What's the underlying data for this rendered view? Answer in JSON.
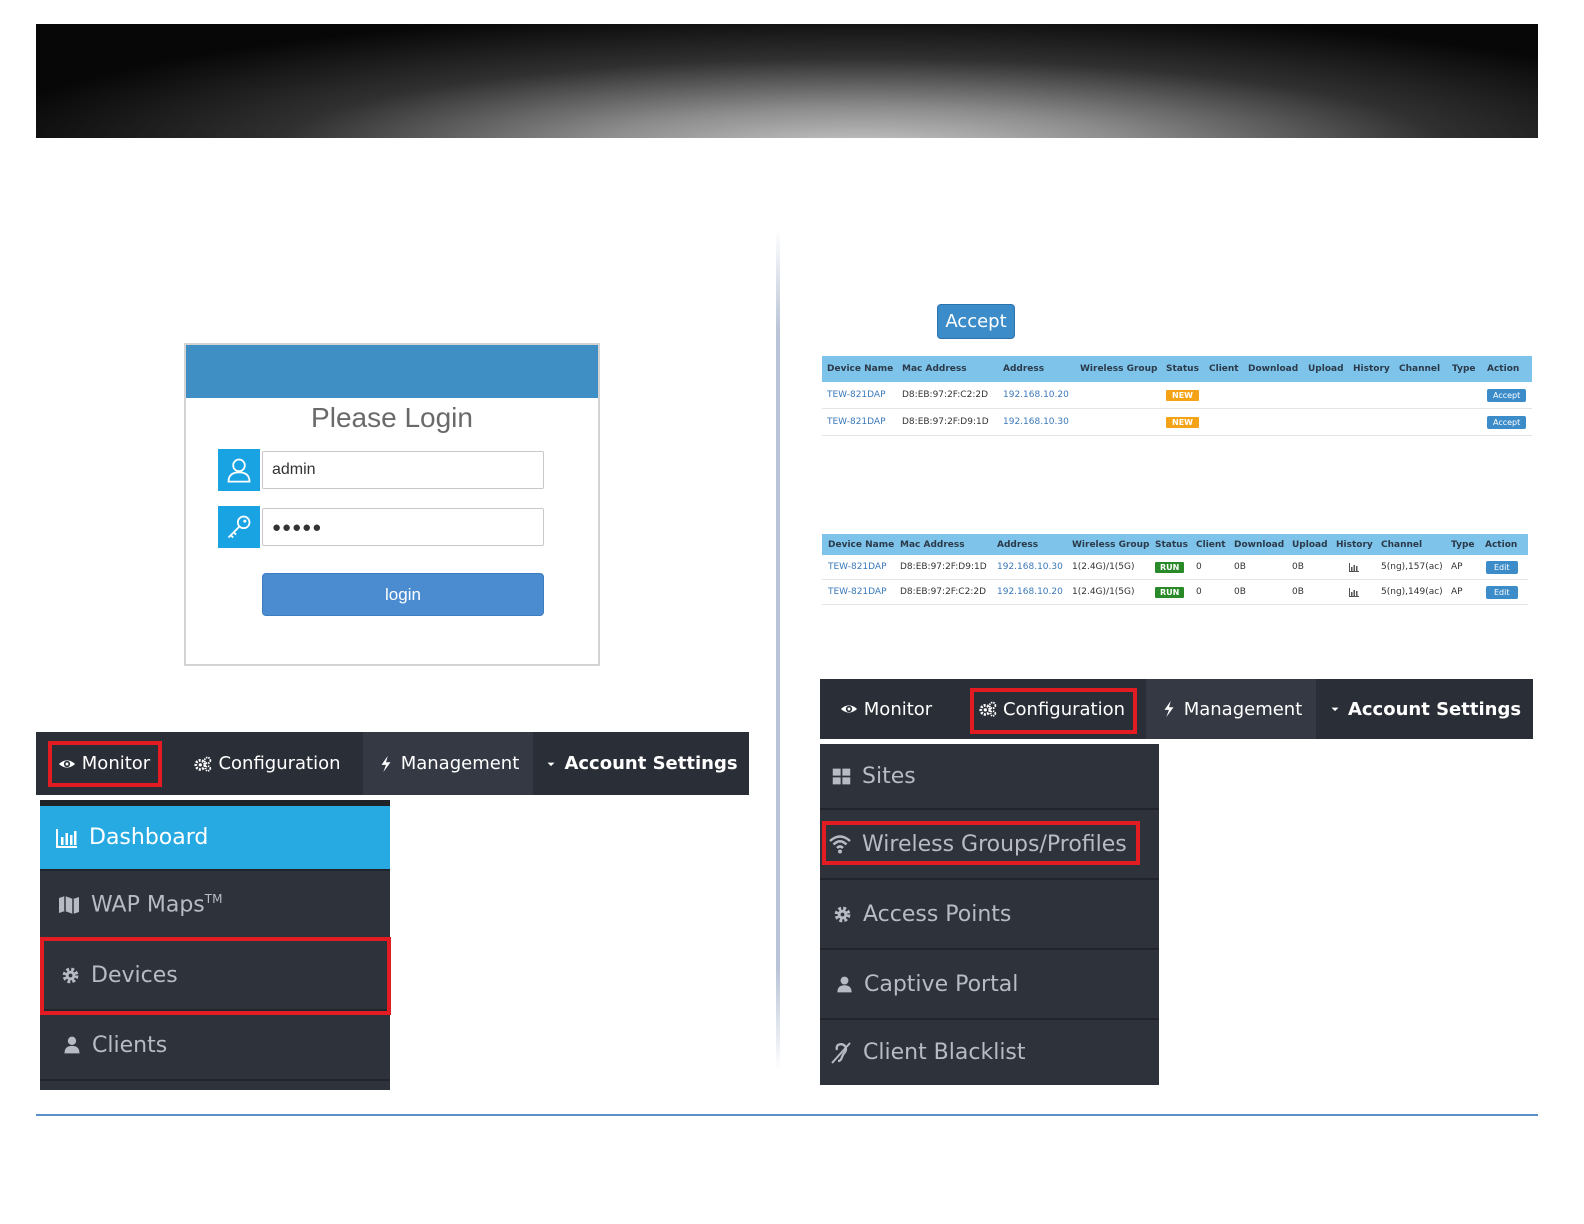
{
  "login": {
    "title": "Please Login",
    "username_value": "admin",
    "password_value": "●●●●●",
    "button_label": "login"
  },
  "nav_left": {
    "monitor": "Monitor",
    "configuration": "Configuration",
    "management": "Management",
    "account_settings": "Account Settings"
  },
  "nav_right": {
    "monitor": "Monitor",
    "configuration": "Configuration",
    "management": "Management",
    "account_settings": "Account Settings"
  },
  "monitor_menu": {
    "dashboard": "Dashboard",
    "wap_maps": "WAP Maps",
    "wap_maps_tm": "TM",
    "devices": "Devices",
    "clients": "Clients"
  },
  "config_menu": {
    "sites": "Sites",
    "wireless_groups": "Wireless Groups/Profiles",
    "access_points": "Access Points",
    "captive_portal": "Captive Portal",
    "client_blacklist": "Client Blacklist"
  },
  "accept_button": "Accept",
  "table_columns": [
    "Device Name",
    "Mac Address",
    "Address",
    "Wireless Group",
    "Status",
    "Client",
    "Download",
    "Upload",
    "History",
    "Channel",
    "Type",
    "Action"
  ],
  "pending_rows": [
    {
      "device": "TEW-821DAP",
      "mac": "D8:EB:97:2F:C2:2D",
      "address": "192.168.10.20",
      "status": "NEW",
      "action": "Accept"
    },
    {
      "device": "TEW-821DAP",
      "mac": "D8:EB:97:2F:D9:1D",
      "address": "192.168.10.30",
      "status": "NEW",
      "action": "Accept"
    }
  ],
  "active_rows": [
    {
      "device": "TEW-821DAP",
      "mac": "D8:EB:97:2F:D9:1D",
      "address": "192.168.10.30",
      "group": "1(2.4G)/1(5G)",
      "status": "RUN",
      "client": "0",
      "download": "0B",
      "upload": "0B",
      "channel": "5(ng),157(ac)",
      "type": "AP",
      "action": "Edit"
    },
    {
      "device": "TEW-821DAP",
      "mac": "D8:EB:97:2F:C2:2D",
      "address": "192.168.10.20",
      "group": "1(2.4G)/1(5G)",
      "status": "RUN",
      "client": "0",
      "download": "0B",
      "upload": "0B",
      "channel": "5(ng),149(ac)",
      "type": "AP",
      "action": "Edit"
    }
  ],
  "colors": {
    "highlight": "#e31b23",
    "nav_bg": "#2a2e36",
    "active_item": "#27aae1",
    "table_header": "#7ec4ea"
  }
}
